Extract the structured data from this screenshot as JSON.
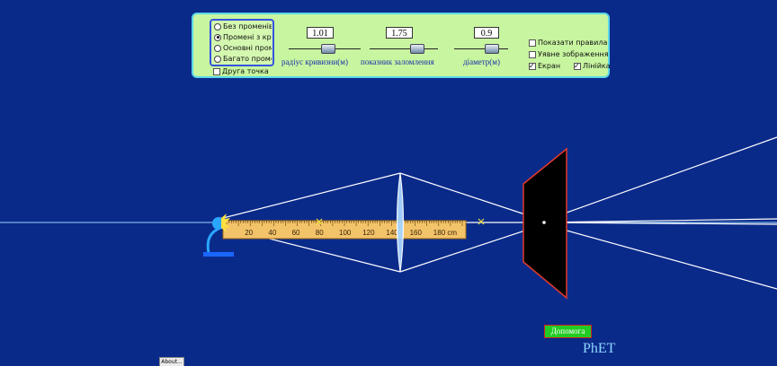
{
  "ray_modes": [
    {
      "label": "Без променів",
      "selected": false
    },
    {
      "label": "Промені з крайніх",
      "selected": true
    },
    {
      "label": "Основні промені",
      "selected": false
    },
    {
      "label": "Багато променів",
      "selected": false
    }
  ],
  "second_point_label": "Друга точка",
  "sliders": {
    "curvature": {
      "value": "1.01",
      "label": "радіус кривизни(м)",
      "level": 0.55
    },
    "refraction": {
      "value": "1.75",
      "label": "показник заломлення",
      "level": 0.7
    },
    "diameter": {
      "value": "0.9",
      "label": "діаметр(м)",
      "level": 0.7
    }
  },
  "options": {
    "show_rules": {
      "label": "Показати правила",
      "checked": false
    },
    "virtual_image": {
      "label": "Уявне зображення",
      "checked": false
    },
    "screen": {
      "label": "Екран",
      "checked": true
    },
    "ruler": {
      "label": "Лінійка",
      "checked": true
    }
  },
  "ruler": {
    "ticks": [
      "20",
      "40",
      "60",
      "80",
      "100",
      "120",
      "140",
      "160",
      "180 cm"
    ]
  },
  "help_label": "Допомога",
  "logo_text": "PhET",
  "about_label": "About...",
  "colors": {
    "background": "#0a2a8a",
    "panel": "#c8f5a0",
    "ruler": "#f3c36a",
    "lens": "#a6d4ff",
    "screen_fill": "#000000",
    "screen_border": "#e03a2a",
    "help_button": "#22cc22",
    "focal_mark": "#f0e040"
  }
}
